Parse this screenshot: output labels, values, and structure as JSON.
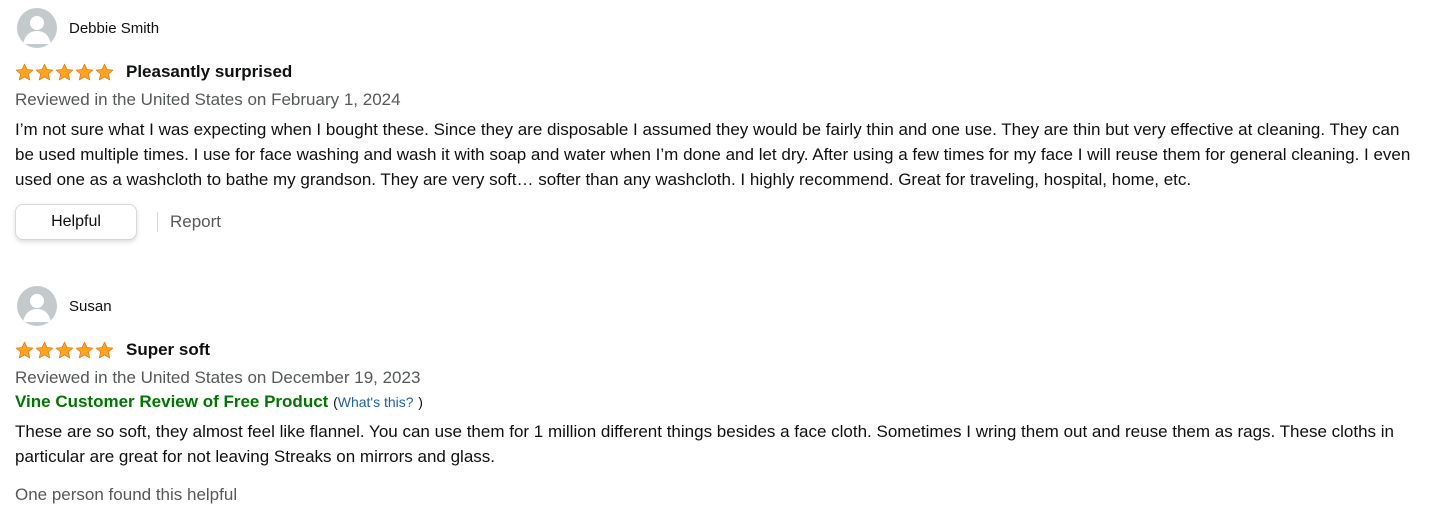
{
  "reviews": [
    {
      "reviewer": "Debbie Smith",
      "rating": 5,
      "title": "Pleasantly surprised",
      "date": "Reviewed in the United States on February 1, 2024",
      "body": "I’m not sure what I was expecting when I bought these. Since they are disposable I assumed they would be fairly thin and one use. They are thin but very effective at cleaning. They can be used multiple times. I use for face washing and wash it with soap and water when I’m done and let dry. After using a few times for my face I will reuse them for general cleaning. I even used one as a washcloth to bathe my grandson. They are very soft… softer than any washcloth. I highly recommend. Great for traveling, hospital, home, etc.",
      "helpful_label": "Helpful",
      "report_label": "Report"
    },
    {
      "reviewer": "Susan",
      "rating": 5,
      "title": "Super soft",
      "date": "Reviewed in the United States on December 19, 2023",
      "vine_label": "Vine Customer Review of Free Product",
      "vine_open": "(",
      "vine_link": "What's this?",
      "vine_close": ")",
      "body": "These are so soft, they almost feel like flannel. You can use them for 1 million different things besides a face cloth. Sometimes I wring them out and reuse them as rags. These cloths in particular are great for not leaving Streaks on mirrors and glass.",
      "found_helpful": "One person found this helpful"
    }
  ],
  "colors": {
    "star": "#ffa41c",
    "vine": "#007600",
    "link": "#2162a1",
    "muted": "#565959"
  },
  "icons": {
    "avatar": "default-user-avatar-icon",
    "star": "star-filled-icon"
  }
}
